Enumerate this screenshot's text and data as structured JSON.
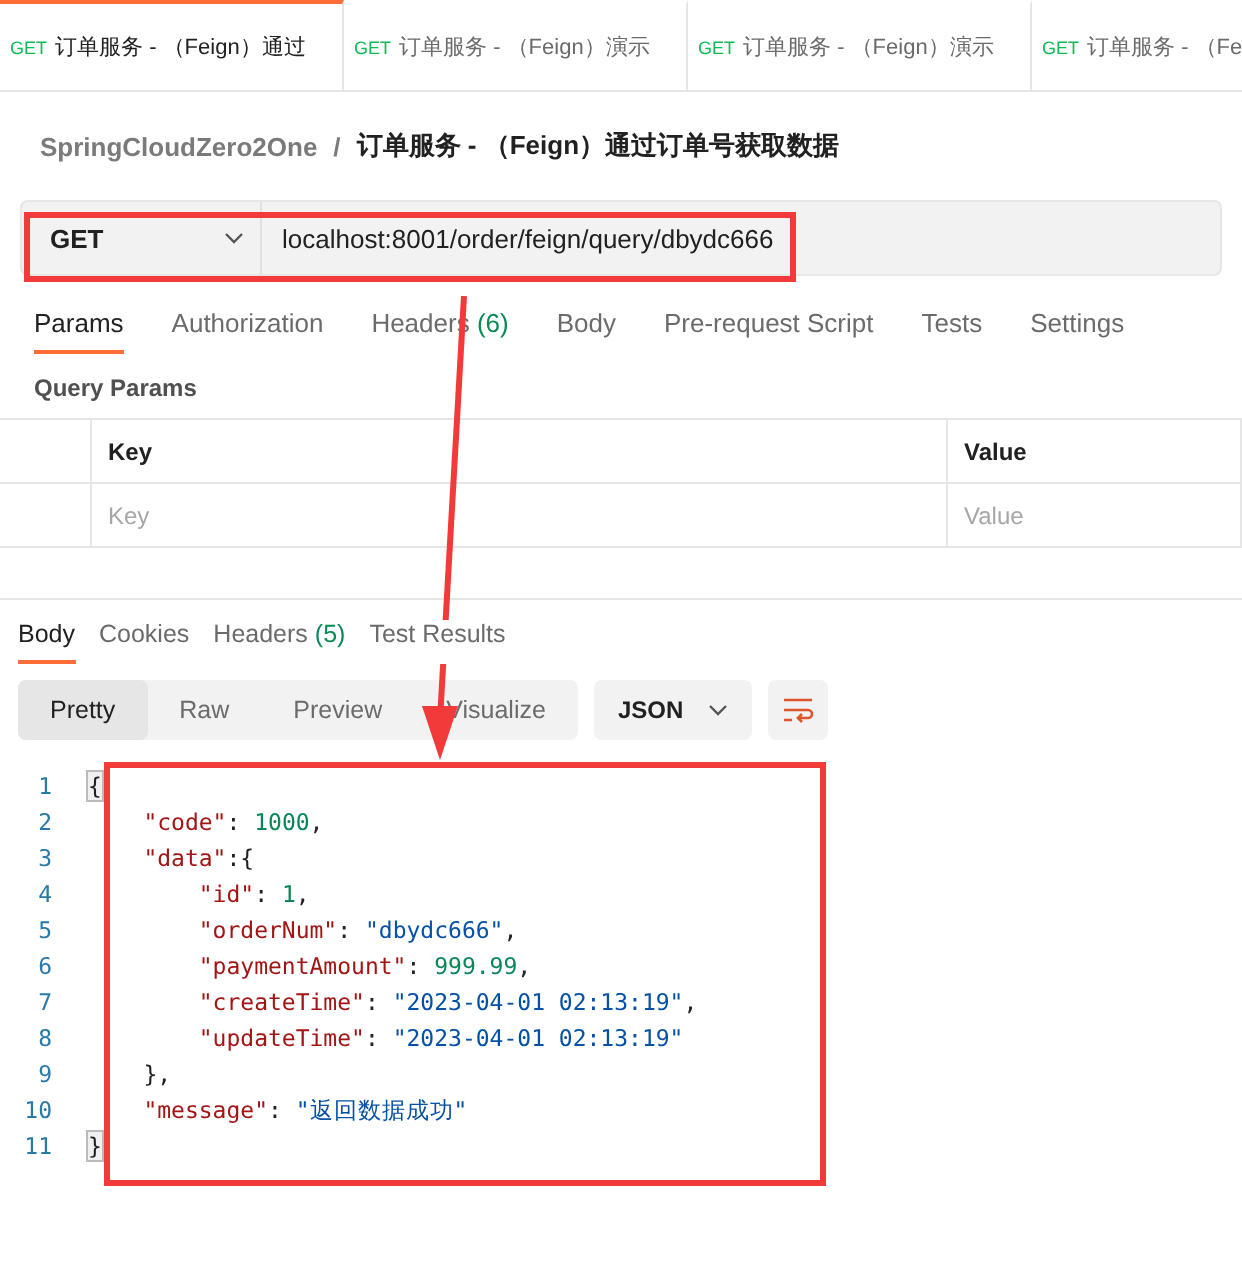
{
  "request_tabs": [
    {
      "method": "GET",
      "title": "订单服务 - （Feign）通过",
      "selected": true
    },
    {
      "method": "GET",
      "title": "订单服务 - （Feign）演示",
      "selected": false
    },
    {
      "method": "GET",
      "title": "订单服务 - （Feign）演示",
      "selected": false
    },
    {
      "method": "GET",
      "title": "订单服务 - （Fe",
      "selected": false
    }
  ],
  "breadcrumb": {
    "collection": "SpringCloudZero2One",
    "separator": "/",
    "request": "订单服务 - （Feign）通过订单号获取数据"
  },
  "url_bar": {
    "method": "GET",
    "url": "localhost:8001/order/feign/query/dbydc666"
  },
  "request_sections": [
    {
      "label": "Params",
      "selected": true
    },
    {
      "label": "Authorization",
      "selected": false
    },
    {
      "label": "Headers",
      "count": "(6)",
      "selected": false
    },
    {
      "label": "Body",
      "selected": false
    },
    {
      "label": "Pre-request Script",
      "selected": false
    },
    {
      "label": "Tests",
      "selected": false
    },
    {
      "label": "Settings",
      "selected": false
    }
  ],
  "query_params": {
    "title": "Query Params",
    "columns": [
      "Key",
      "Value"
    ],
    "placeholders": [
      "Key",
      "Value"
    ]
  },
  "response_sections": [
    {
      "label": "Body",
      "selected": true
    },
    {
      "label": "Cookies",
      "selected": false
    },
    {
      "label": "Headers",
      "count": "(5)",
      "selected": false
    },
    {
      "label": "Test Results",
      "selected": false
    }
  ],
  "view_modes": [
    {
      "label": "Pretty",
      "selected": true
    },
    {
      "label": "Raw",
      "selected": false
    },
    {
      "label": "Preview",
      "selected": false
    },
    {
      "label": "Visualize",
      "selected": false
    }
  ],
  "format": "JSON",
  "code_lines": [
    {
      "number": "1",
      "tokens": [
        {
          "kind": "brace",
          "text": "{"
        }
      ],
      "children": [
        {
          "number": "2",
          "tokens": [
            {
              "kind": "key",
              "text": "\"code\""
            },
            {
              "kind": "punct",
              "text": ":"
            },
            {
              "kind": "num",
              "text": "1000"
            },
            {
              "kind": "punct",
              "text": ","
            }
          ]
        },
        {
          "number": "3",
          "tokens": [
            {
              "kind": "key",
              "text": "\"data\""
            },
            {
              "kind": "punct",
              "text": ":"
            },
            {
              "kind": "punct",
              "text": "{"
            }
          ],
          "children": [
            {
              "number": "4",
              "tokens": [
                {
                  "kind": "key",
                  "text": "\"id\""
                },
                {
                  "kind": "punct",
                  "text": ":"
                },
                {
                  "kind": "num",
                  "text": "1"
                },
                {
                  "kind": "punct",
                  "text": ","
                }
              ]
            },
            {
              "number": "5",
              "tokens": [
                {
                  "kind": "key",
                  "text": "\"orderNum\""
                },
                {
                  "kind": "punct",
                  "text": ":"
                },
                {
                  "kind": "str",
                  "text": "\"dbydc666\""
                },
                {
                  "kind": "punct",
                  "text": ","
                }
              ]
            },
            {
              "number": "6",
              "tokens": [
                {
                  "kind": "key",
                  "text": "\"paymentAmount\""
                },
                {
                  "kind": "punct",
                  "text": ":"
                },
                {
                  "kind": "num",
                  "text": "999.99"
                },
                {
                  "kind": "punct",
                  "text": ","
                }
              ]
            },
            {
              "number": "7",
              "tokens": [
                {
                  "kind": "key",
                  "text": "\"createTime\""
                },
                {
                  "kind": "punct",
                  "text": ":"
                },
                {
                  "kind": "str",
                  "text": "\"2023-04-01 02:13:19\""
                },
                {
                  "kind": "punct",
                  "text": ","
                }
              ]
            },
            {
              "number": "8",
              "tokens": [
                {
                  "kind": "key",
                  "text": "\"updateTime\""
                },
                {
                  "kind": "punct",
                  "text": ":"
                },
                {
                  "kind": "str",
                  "text": "\"2023-04-01 02:13:19\""
                }
              ]
            }
          ]
        },
        {
          "number": "9",
          "tokens": [
            {
              "kind": "punct",
              "text": "},"
            }
          ]
        },
        {
          "number": "10",
          "tokens": [
            {
              "kind": "key",
              "text": "\"message\""
            },
            {
              "kind": "punct",
              "text": ":"
            },
            {
              "kind": "str",
              "text": "\"返回数据成功\""
            }
          ]
        }
      ]
    },
    {
      "number": "11",
      "tokens": [
        {
          "kind": "brace",
          "text": "}"
        }
      ]
    }
  ]
}
